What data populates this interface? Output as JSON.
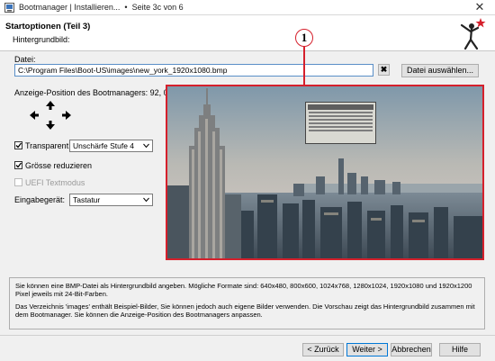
{
  "window": {
    "title": "Bootmanager | Installieren...",
    "page_info": "Seite 3c von 6",
    "close_glyph": "✕"
  },
  "header": {
    "title": "Startoptionen (Teil 3)",
    "subtitle": "Hintergrundbild:"
  },
  "file": {
    "label": "Datei:",
    "value": "C:\\Program Files\\Boot-US\\images\\new_york_1920x1080.bmp",
    "clear_glyph": "✖",
    "browse_label": "Datei auswählen..."
  },
  "position": {
    "label": "Anzeige-Position des Bootmanagers: 92, 0"
  },
  "options": {
    "transparent_label": "Transparent",
    "transparent_checked": true,
    "blur_value": "Unschärfe Stufe 4",
    "shrink_label": "Grösse reduzieren",
    "shrink_checked": true,
    "uefi_label": "UEFI Textmodus",
    "uefi_checked": false,
    "input_device_label": "Eingabegerät:",
    "input_device_value": "Tastatur"
  },
  "callout": {
    "number": "1",
    "color": "#d5202c"
  },
  "info": {
    "para1": "Sie können eine BMP-Datei als Hintergrundbild angeben. Mögliche Formate sind: 640x480, 800x600, 1024x768, 1280x1024, 1920x1080 und 1920x1200 Pixel jeweils mit 24-Bit-Farben.",
    "para2": "Das Verzeichnis 'images' enthält Beispiel-Bilder, Sie können jedoch auch eigene Bilder verwenden. Die Vorschau zeigt das Hintergrundbild zusammen mit dem Bootmanager. Sie können die Anzeige-Position des Bootmanagers anpassen."
  },
  "buttons": {
    "back": "< Zurück",
    "next": "Weiter >",
    "cancel": "Abbrechen",
    "help": "Hilfe"
  },
  "icons": {
    "app": "bootmanager-app-icon",
    "logo": "person-star-logo",
    "arrows": [
      "arrow-up-icon",
      "arrow-left-icon",
      "arrow-right-icon",
      "arrow-down-icon"
    ]
  }
}
